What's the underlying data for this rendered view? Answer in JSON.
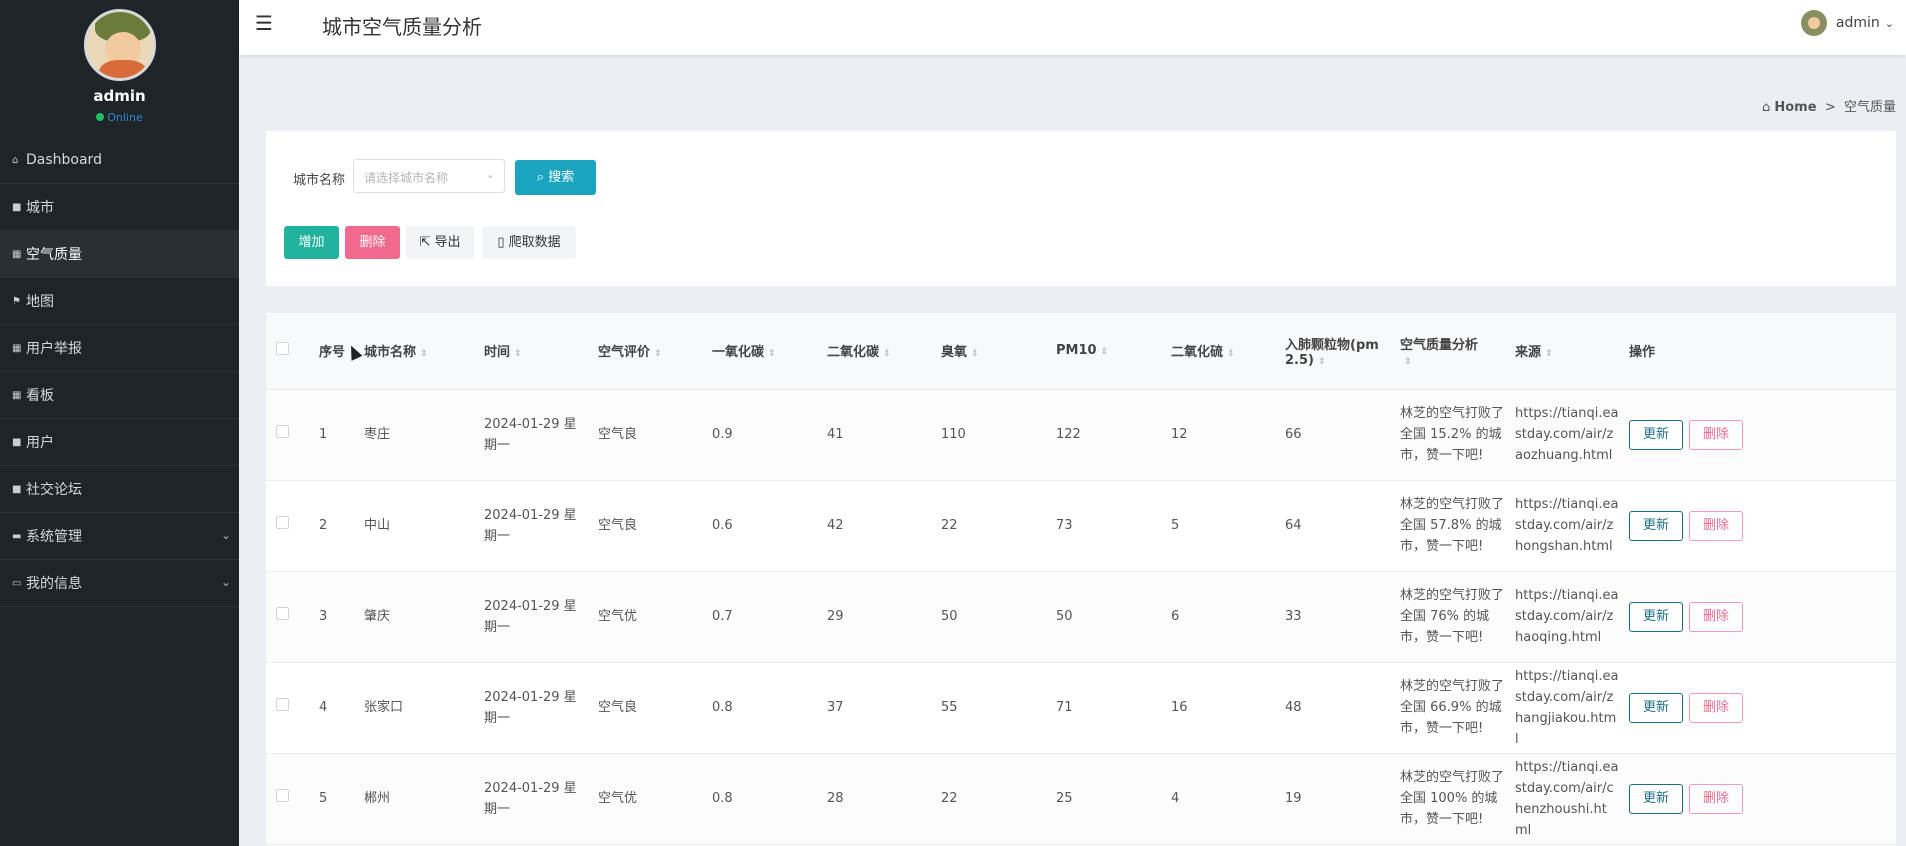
{
  "sidebar": {
    "username": "admin",
    "status": "Online",
    "items": [
      {
        "label": "Dashboard",
        "icon": "home-icon"
      },
      {
        "label": "城市",
        "icon": "doc-icon"
      },
      {
        "label": "空气质量",
        "icon": "grid-icon",
        "active": true
      },
      {
        "label": "地图",
        "icon": "flag-icon"
      },
      {
        "label": "用户举报",
        "icon": "grid-icon"
      },
      {
        "label": "看板",
        "icon": "grid-icon"
      },
      {
        "label": "用户",
        "icon": "doc-icon"
      },
      {
        "label": "社交论坛",
        "icon": "doc-icon"
      },
      {
        "label": "系统管理",
        "icon": "settings-icon",
        "expandable": true
      },
      {
        "label": "我的信息",
        "icon": "card-icon",
        "expandable": true
      }
    ]
  },
  "header": {
    "title": "城市空气质量分析",
    "user": "admin"
  },
  "breadcrumb": {
    "home": "Home",
    "separator": ">",
    "current": "空气质量"
  },
  "search": {
    "label": "城市名称",
    "placeholder": "请选择城市名称",
    "button": "搜索"
  },
  "actions": {
    "add": "增加",
    "delete": "删除",
    "export": "导出",
    "crawl": "爬取数据"
  },
  "table": {
    "columns": [
      "序号",
      "城市名称",
      "时间",
      "空气评价",
      "一氧化碳",
      "二氧化碳",
      "臭氧",
      "PM10",
      "二氧化硫",
      "入肺颗粒物(pm2.5)",
      "空气质量分析",
      "来源",
      "操作"
    ],
    "rows": [
      {
        "id": "1",
        "city": "枣庄",
        "time": "2024-01-29 星期一",
        "rating": "空气良",
        "co": "0.9",
        "co2": "41",
        "o3": "110",
        "pm10": "122",
        "so2": "12",
        "pm25": "66",
        "analysis": "林芝的空气打败了全国 15.2% 的城市，赞一下吧!",
        "source": "https://tianqi.eastday.com/air/zaozhuang.html"
      },
      {
        "id": "2",
        "city": "中山",
        "time": "2024-01-29 星期一",
        "rating": "空气良",
        "co": "0.6",
        "co2": "42",
        "o3": "22",
        "pm10": "73",
        "so2": "5",
        "pm25": "64",
        "analysis": "林芝的空气打败了全国 57.8% 的城市，赞一下吧!",
        "source": "https://tianqi.eastday.com/air/zhongshan.html"
      },
      {
        "id": "3",
        "city": "肇庆",
        "time": "2024-01-29 星期一",
        "rating": "空气优",
        "co": "0.7",
        "co2": "29",
        "o3": "50",
        "pm10": "50",
        "so2": "6",
        "pm25": "33",
        "analysis": "林芝的空气打败了全国 76% 的城市，赞一下吧!",
        "source": "https://tianqi.eastday.com/air/zhaoqing.html"
      },
      {
        "id": "4",
        "city": "张家口",
        "time": "2024-01-29 星期一",
        "rating": "空气良",
        "co": "0.8",
        "co2": "37",
        "o3": "55",
        "pm10": "71",
        "so2": "16",
        "pm25": "48",
        "analysis": "林芝的空气打败了全国 66.9% 的城市，赞一下吧!",
        "source": "https://tianqi.eastday.com/air/zhangjiakou.html"
      },
      {
        "id": "5",
        "city": "郴州",
        "time": "2024-01-29 星期一",
        "rating": "空气优",
        "co": "0.8",
        "co2": "28",
        "o3": "22",
        "pm10": "25",
        "so2": "4",
        "pm25": "19",
        "analysis": "林芝的空气打败了全国 100% 的城市，赞一下吧!",
        "source": "https://tianqi.eastday.com/air/chenzhoushi.html"
      }
    ],
    "update_label": "更新",
    "delete_label": "删除"
  }
}
